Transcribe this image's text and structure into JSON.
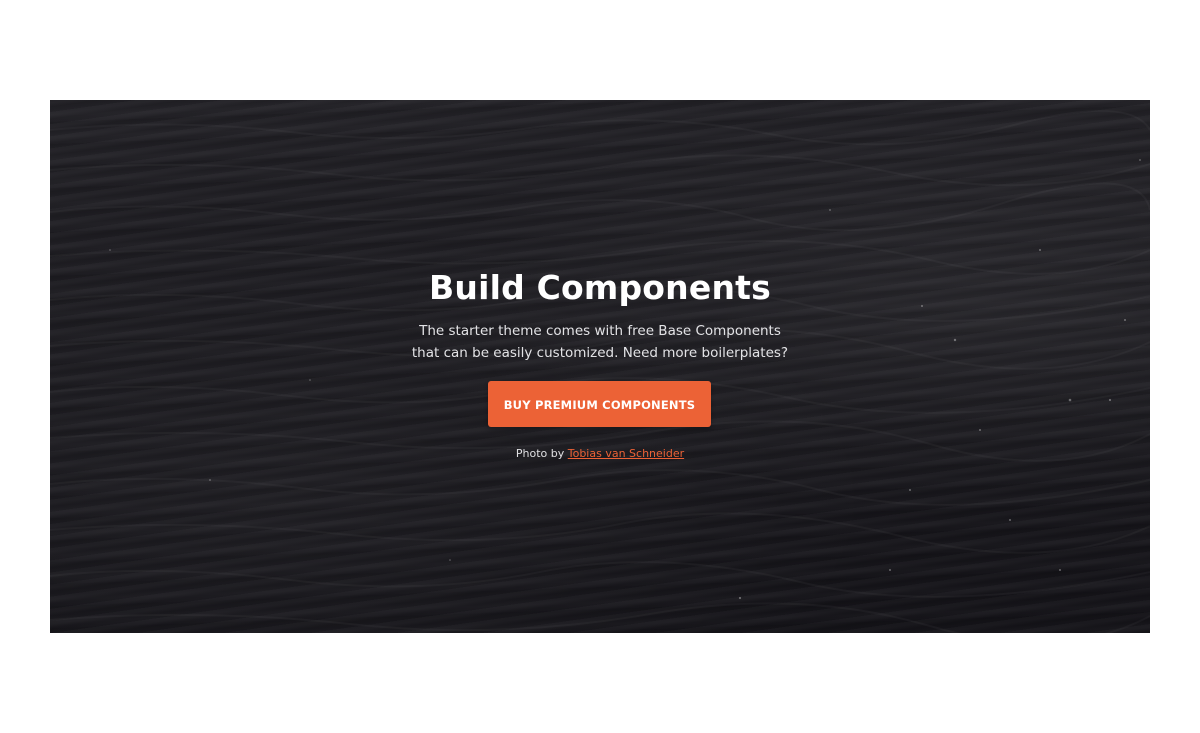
{
  "hero": {
    "title": "Build Components",
    "description_lines": [
      "The starter theme comes with free Base Components",
      "that can be easily customized. Need more boilerplates?"
    ],
    "cta_label": "BUY PREMIUM COMPONENTS",
    "credit_prefix": "Photo by",
    "credit_link_text": "Tobias van Schneider"
  },
  "colors": {
    "accent": "#ec6236",
    "hero_background": "#1b1a1f",
    "page_background": "#ffffff",
    "title_text": "#ffffff"
  }
}
